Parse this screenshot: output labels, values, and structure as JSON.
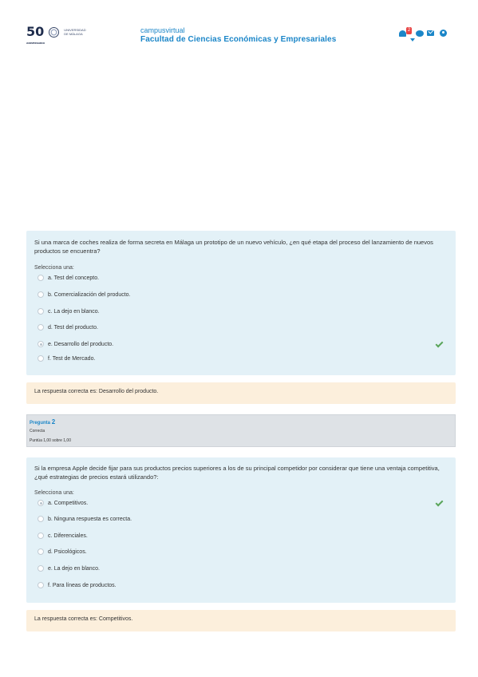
{
  "header": {
    "logo_number": "50",
    "logo_number_sub": "ANIVERSARIO",
    "logo_university": "UNIVERSIDAD DE MÁLAGA",
    "site_small": "campusvirtual",
    "site_title": "Facultad de Ciencias Económicas y Empresariales",
    "notification_count": "2",
    "icons": [
      "bell-icon",
      "chat-icon",
      "mail-icon",
      "user-icon"
    ],
    "accent_color": "#1b86c8"
  },
  "question1": {
    "text": "Si una marca de coches realiza de forma secreta en Málaga un prototipo de un nuevo vehículo, ¿en qué etapa del proceso del lanzamiento de nuevos productos se encuentra?",
    "select_label": "Selecciona una:",
    "options": [
      "a. Test del concepto.",
      "b. Comercialización del producto.",
      "c. La dejo en blanco.",
      "d. Test del producto.",
      "e. Desarrollo del producto.",
      "f. Test de Mercado."
    ],
    "selected_index": 4,
    "feedback": "La respuesta correcta es: Desarrollo del producto."
  },
  "question2_info": {
    "label": "Pregunta",
    "number": "2",
    "state": "Correcta",
    "grade": "Puntúa 1,00 sobre 1,00"
  },
  "question2": {
    "text": "Si la empresa Apple decide fijar para sus productos precios superiores a los de su principal competidor por considerar que tiene una ventaja competitiva, ¿qué estrategias de precios estará utilizando?:",
    "select_label": "Selecciona una:",
    "options": [
      "a. Competitivos.",
      "b. Ninguna respuesta es correcta.",
      "c. Diferenciales.",
      "d. Psicológicos.",
      "e. La dejo en blanco.",
      "f. Para líneas de productos."
    ],
    "selected_index": 0,
    "feedback": "La respuesta correcta es: Competitivos."
  }
}
